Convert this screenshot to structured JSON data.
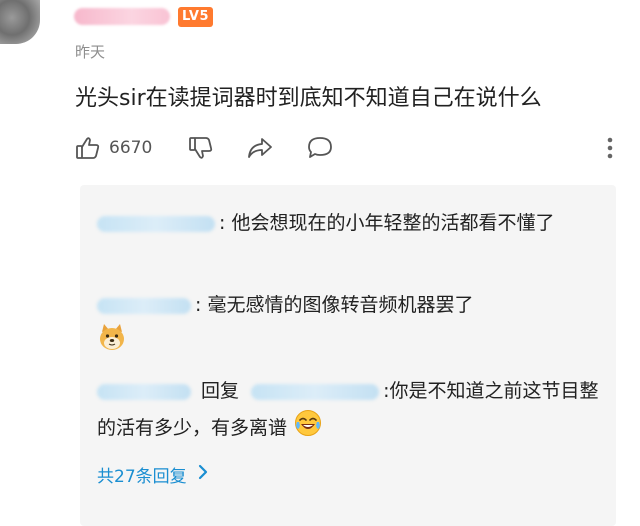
{
  "comment": {
    "level_badge": "LV5",
    "time": "昨天",
    "text": "光头sir在读提词器时到底知不知道自己在说什么",
    "like_count": "6670"
  },
  "replies": [
    {
      "text": ": 他会想现在的小年轻整的活都看不懂了"
    },
    {
      "text": ": 毫无感情的图像转音频机器罢了"
    },
    {
      "reply_word": "回复",
      "text": ":你是不知道之前这节目整的活有多少，有多离谱"
    }
  ],
  "view_all_label": "共27条回复",
  "icons": {
    "like": "thumbs-up-icon",
    "dislike": "thumbs-down-icon",
    "share": "share-icon",
    "comment": "comment-bubble-icon",
    "more": "more-vertical-icon",
    "chevron": "chevron-right-icon"
  },
  "colors": {
    "badge": "#ff7a2f",
    "link": "#1a8ed1",
    "reply_bg": "#f5f5f5"
  }
}
